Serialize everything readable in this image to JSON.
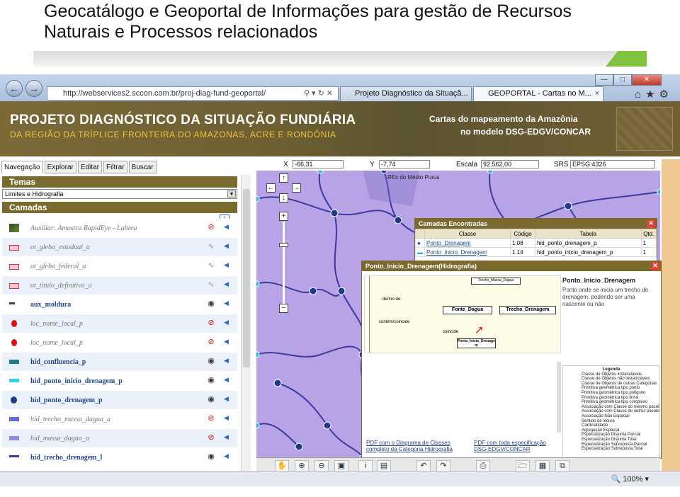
{
  "slide": {
    "title_line1": "Geocatálogo e Geoportal de Informações para gestão de Recursos",
    "title_line2": "Naturais e Processos relacionados"
  },
  "browser": {
    "url": "http://webservices2.sccon.com.br/proj-diag-fund-geoportal/",
    "tabs": [
      {
        "label": "Projeto Diagnóstico da Situaçã..."
      },
      {
        "label": "GEOPORTAL - Cartas no M..."
      }
    ],
    "zoom_level": "100%"
  },
  "banner": {
    "title": "PROJETO DIAGNÓSTICO DA SITUAÇÃO FUNDIÁRIA",
    "subtitle": "DA REGIÃO DA TRÍPLICE FRONTEIRA DO AMAZONAS, ACRE E RONDÔNIA",
    "right_line1": "Cartas do mapeamento da Amazônia",
    "right_line2": "no modelo DSG-EDGV/CONCAR"
  },
  "left_panel": {
    "tabs": [
      "Navegação",
      "Explorar",
      "Editar",
      "Filtrar",
      "Buscar"
    ],
    "temas_label": "Temas",
    "temas_selected": "Limites e Hidrografia",
    "camadas_label": "Camadas",
    "layers": [
      {
        "name": "Auxiliar: Amostra RapidEye - Labrea",
        "on": false,
        "symbol": "image",
        "visibility": "hidden-red"
      },
      {
        "name": "ot_gleba_estadual_a",
        "on": false,
        "symbol": "polygon-pink",
        "visibility": "eye-faded"
      },
      {
        "name": "ot_gleba_federal_a",
        "on": false,
        "symbol": "polygon-pink",
        "visibility": "eye-faded"
      },
      {
        "name": "ot_titulo_definitivo_a",
        "on": false,
        "symbol": "polygon-pink",
        "visibility": "eye-faded"
      },
      {
        "name": "aux_moldura",
        "on": true,
        "symbol": "line-dark",
        "visibility": "eye"
      },
      {
        "name": "loc_nome_local_p",
        "on": false,
        "symbol": "point-red",
        "visibility": "hidden-red"
      },
      {
        "name": "loc_nome_local_p",
        "on": false,
        "symbol": "point-red",
        "visibility": "hidden-red"
      },
      {
        "name": "hid_confluencia_p",
        "on": true,
        "symbol": "rect-teal",
        "visibility": "eye"
      },
      {
        "name": "hid_ponto_inicio_drenagem_p",
        "on": true,
        "symbol": "rect-cyan",
        "visibility": "eye"
      },
      {
        "name": "hid_ponto_drenagem_p",
        "on": true,
        "symbol": "point-navy",
        "visibility": "eye"
      },
      {
        "name": "hid_trecho_massa_dagua_a",
        "on": false,
        "symbol": "rect-blue",
        "visibility": "hidden-red"
      },
      {
        "name": "hid_massa_dagua_a",
        "on": false,
        "symbol": "rect-purple",
        "visibility": "hidden-red"
      },
      {
        "name": "hid_trecho_drenagem_l",
        "on": true,
        "symbol": "line-blue",
        "visibility": "eye"
      }
    ]
  },
  "map": {
    "x_label": "X",
    "x_value": "-66,31",
    "y_label": "Y",
    "y_value": "-7,74",
    "escala_label": "Escala",
    "escala_value": "92.562,00",
    "srs_label": "SRS",
    "srs_value": "EPSG:4326",
    "place_label": "REx do Médio Purus"
  },
  "found_layers": {
    "title": "Camadas Encontradas",
    "columns": [
      "Classe",
      "Código",
      "Tabela",
      "Qtd."
    ],
    "rows": [
      {
        "classe": "Ponto_Drenagem",
        "codigo": "1.08",
        "tabela": "hid_ponto_drenagem_p",
        "qtd": "1"
      },
      {
        "classe": "Ponto_Inicio_Drenagem",
        "codigo": "1.14",
        "tabela": "hid_ponto_inicio_drenagem_p",
        "qtd": "1"
      }
    ]
  },
  "class_popup": {
    "title": "Ponto_Inicio_Drenagem(Hidrografia)",
    "desc_title": "Ponto_Inicio_Drenagem",
    "description": "Ponto onde se inicia um trecho de drenagem, podendo ser uma nascente ou não",
    "diagram_boxes": [
      "Trecho_Massa_Dagua",
      "Fonte_Dagua",
      "Trecho_Drenagem",
      "Ponto_Inicio_Drenagem"
    ],
    "diagram_text": [
      "dentro de",
      "coincide",
      "contém/coincide"
    ],
    "legend_title": "Legenda",
    "legend_items": [
      "Classe de Objetos instanciáveis",
      "Classe de Objetos não instanciáveis",
      "Classe de Objetos de outras Categorias",
      "Primitiva geométrica tipo ponto",
      "Primitiva geométrica tipo polígono",
      "Primitiva geométrica tipo linha",
      "Primitiva geométrica tipo complexo",
      "Associação com Classe do mesmo pacote",
      "Associação com Classe de outros pacotes",
      "Associação Não Espacial",
      "Sentido de leitura",
      "Cardinalidade",
      "Agregação Espacial",
      "Especialização Disjunta Parcial",
      "Especialização Disjunta Total",
      "Especialização Sobreposta Parcial",
      "Especialização Sobreposta Total"
    ],
    "link1_line1": "PDF com o Diagrama de Classes",
    "link1_line2": "completo da Categoria Hidrografia",
    "link2_line1": "PDF com toda especificação",
    "link2_line2": "DSG-EDGV/CONCAR"
  },
  "colors": {
    "header_olive": "#7a6a2e",
    "map_purple": "#b7a3e6",
    "river": "#3a3aa0",
    "node": "#1e3a8a"
  }
}
